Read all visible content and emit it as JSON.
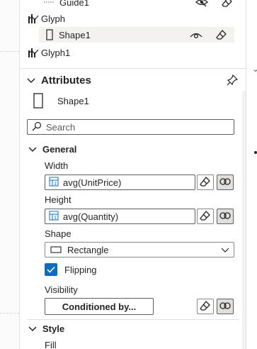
{
  "tree": {
    "items": [
      {
        "label": "Guide1",
        "icon": "guide-icon"
      },
      {
        "label": "Glyph",
        "icon": "glyph-icon"
      },
      {
        "label": "Shape1",
        "icon": "rectangle-shape-icon",
        "selected": true
      },
      {
        "label": "Glyph1",
        "icon": "glyph-icon"
      }
    ]
  },
  "attributes": {
    "title": "Attributes",
    "object_name": "Shape1",
    "search_placeholder": "Search"
  },
  "general": {
    "title": "General",
    "width_label": "Width",
    "width_value": "avg(UnitPrice)",
    "height_label": "Height",
    "height_value": "avg(Quantity)",
    "shape_label": "Shape",
    "shape_value": "Rectangle",
    "flipping_label": "Flipping",
    "flipping_checked": true,
    "visibility_label": "Visibility",
    "visibility_button": "Conditioned by..."
  },
  "style": {
    "title": "Style",
    "fill_label": "Fill"
  },
  "colors": {
    "accent": "#0f6cbd",
    "border": "#605e5c",
    "selected_row": "#f3f2f1"
  }
}
